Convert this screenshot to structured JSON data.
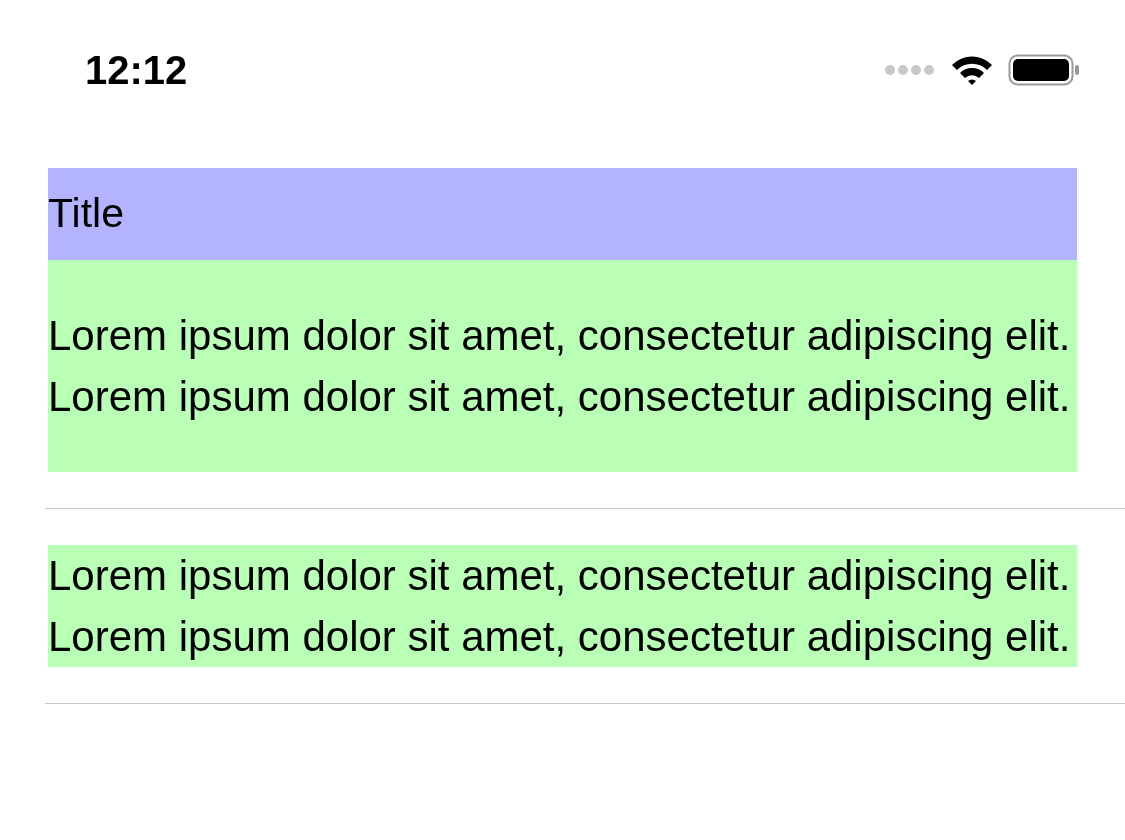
{
  "status_bar": {
    "time": "12:12"
  },
  "cells": [
    {
      "title": "Title",
      "body": "Lorem ipsum dolor sit amet, consectetur adipiscing elit. Lorem ipsum dolor sit amet, consectetur adipiscing elit."
    },
    {
      "body": "Lorem ipsum dolor sit amet, consectetur adipiscing elit. Lorem ipsum dolor sit amet, consectetur adipiscing elit."
    }
  ]
}
